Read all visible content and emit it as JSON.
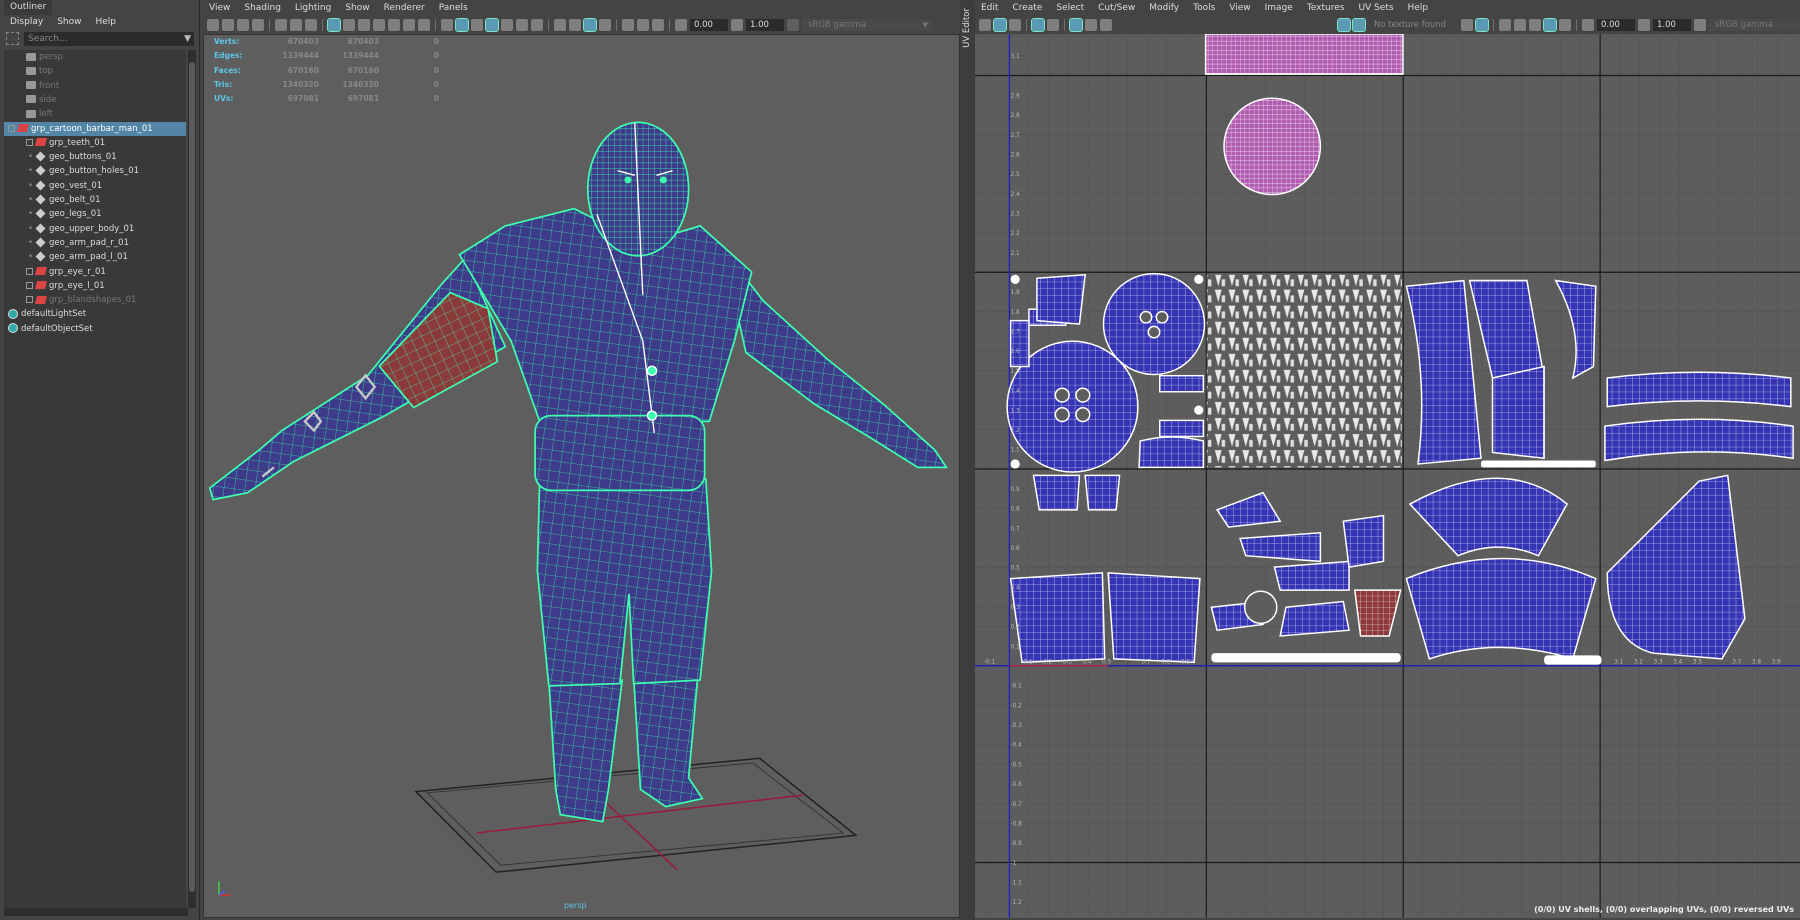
{
  "outliner": {
    "tab": "Outliner",
    "menu": [
      "Display",
      "Show",
      "Help"
    ],
    "search_placeholder": "Search...",
    "items": [
      {
        "label": "persp",
        "type": "camera",
        "depth": 1,
        "dim": true
      },
      {
        "label": "top",
        "type": "camera",
        "depth": 1,
        "dim": true
      },
      {
        "label": "front",
        "type": "camera",
        "depth": 1,
        "dim": true
      },
      {
        "label": "side",
        "type": "camera",
        "depth": 1,
        "dim": true
      },
      {
        "label": "left",
        "type": "camera",
        "depth": 1,
        "dim": true
      },
      {
        "label": "grp_cartoon_barbar_man_01",
        "type": "group",
        "depth": 0,
        "selected": true,
        "expand": true
      },
      {
        "label": "grp_teeth_01",
        "type": "group",
        "depth": 1,
        "expand": true
      },
      {
        "label": "geo_buttons_01",
        "type": "mesh",
        "depth": 1
      },
      {
        "label": "geo_button_holes_01",
        "type": "mesh",
        "depth": 1
      },
      {
        "label": "geo_vest_01",
        "type": "mesh",
        "depth": 1
      },
      {
        "label": "geo_belt_01",
        "type": "mesh",
        "depth": 1
      },
      {
        "label": "geo_legs_01",
        "type": "mesh",
        "depth": 1
      },
      {
        "label": "geo_upper_body_01",
        "type": "mesh",
        "depth": 1
      },
      {
        "label": "geo_arm_pad_r_01",
        "type": "mesh",
        "depth": 1
      },
      {
        "label": "geo_arm_pad_l_01",
        "type": "mesh",
        "depth": 1
      },
      {
        "label": "grp_eye_r_01",
        "type": "group",
        "depth": 1,
        "expand": true
      },
      {
        "label": "grp_eye_l_01",
        "type": "group",
        "depth": 1,
        "expand": true
      },
      {
        "label": "grp_blandshapes_01",
        "type": "group",
        "depth": 1,
        "expand": true,
        "dim": true
      },
      {
        "label": "defaultLightSet",
        "type": "set",
        "depth": 0
      },
      {
        "label": "defaultObjectSet",
        "type": "set",
        "depth": 0
      }
    ]
  },
  "viewport": {
    "menu": [
      "View",
      "Shading",
      "Lighting",
      "Show",
      "Renderer",
      "Panels"
    ],
    "toolbar_icons": [
      "camera-icon",
      "camera-attributes-icon",
      "bookmark-camera-icon",
      "bookmark-icon",
      "sep",
      "image-plane-icon",
      "pivot-icon",
      "grease-pencil-icon",
      "sep",
      "grid-icon:on",
      "film-gate-icon",
      "resolution-gate-icon",
      "gate-mask-icon",
      "field-chart-icon",
      "safe-action-icon",
      "safe-title-icon",
      "sep",
      "wireframe-icon",
      "smooth-shade-icon:on",
      "default-material-icon",
      "wireframe-on-shaded-icon:on",
      "xray-icon",
      "use-all-lights-icon",
      "shadows-icon",
      "sep",
      "ambient-occlusion-icon",
      "motion-blur-icon",
      "anti-aliasing-icon:on",
      "depth-of-field-icon",
      "sep",
      "isolate-select-icon",
      "xray-joints-icon",
      "xray-active-icon",
      "sep",
      "exposure-icon"
    ],
    "exposure": "0.00",
    "gamma": "1.00",
    "color_space": "sRGB gamma",
    "stats": [
      {
        "label": "Verts:",
        "a": "670403",
        "b": "670403",
        "c": "0"
      },
      {
        "label": "Edges:",
        "a": "1339444",
        "b": "1339444",
        "c": "0"
      },
      {
        "label": "Faces:",
        "a": "670160",
        "b": "670160",
        "c": "0"
      },
      {
        "label": "Tris:",
        "a": "1340320",
        "b": "1340320",
        "c": "0"
      },
      {
        "label": "UVs:",
        "a": "697081",
        "b": "697081",
        "c": "0"
      }
    ],
    "camera_label": "persp",
    "colors": {
      "mesh": "#3e3b8a",
      "wire": "#3dffb0",
      "highlight": "#8b3a3a"
    }
  },
  "uv_editor": {
    "tab": "UV Editor",
    "menu": [
      "Edit",
      "Create",
      "Select",
      "Cut/Sew",
      "Modify",
      "Tools",
      "View",
      "Image",
      "Textures",
      "UV Sets",
      "Help"
    ],
    "toolbar_icons": [
      "uv-grid-icon",
      "uv-shell-on-icon:on",
      "uv-distortion-icon",
      "sep",
      "checker-icon:on",
      "texture-borders-icon",
      "sep",
      "uv-grid-toggle-icon:on",
      "pixel-snap-icon",
      "snapshot-icon"
    ],
    "texture_icons": [
      "image-display-icon:on",
      "checker-map-icon:on"
    ],
    "texture_status": "No texture found",
    "right_icons": [
      "rgb-channels-icon",
      "image-ratio-icon:on",
      "sep",
      "dim-image-icon",
      "filter-icon",
      "shaded-uvs-icon",
      "display-image-icon:on",
      "psd-icon",
      "sep",
      "exposure-icon"
    ],
    "exposure": "0.00",
    "gamma": "1.00",
    "color_space": "sRGB gamma",
    "u_labels": [
      "-0.2",
      "-0.1",
      "0.1",
      "0.2",
      "0.3",
      "0.4",
      "0.5",
      "0.7",
      "0.8",
      "0.9",
      "3.1",
      "3.2",
      "3.3",
      "3.4",
      "3.5",
      "3.7",
      "3.8",
      "3.9"
    ],
    "v_labels_below": [
      "-0.1",
      "-0.2",
      "-0.3",
      "-0.4",
      "-0.5",
      "-0.6",
      "-0.7",
      "-0.8",
      "-0.9",
      "-1",
      "-1.1",
      "-1.2"
    ],
    "v_labels_above": [
      "0.1",
      "0.2",
      "0.3",
      "0.4",
      "0.5",
      "0.6",
      "0.7",
      "0.8",
      "0.9",
      "1.1",
      "1.2",
      "1.3",
      "1.4",
      "1.5",
      "1.6",
      "1.7",
      "1.8",
      "1.9",
      "2.1",
      "2.2",
      "2.3",
      "2.4",
      "2.5",
      "2.6",
      "2.7",
      "2.8",
      "2.9",
      "3.1"
    ],
    "status": "(0/0) UV shells, (0/0) overlapping UVs, (0/0) reversed UVs",
    "colors": {
      "shell": "#3434b4",
      "shell_pink": "#b05cb0",
      "shell_red": "#8e3a3a",
      "axis": "#2020c0"
    }
  }
}
